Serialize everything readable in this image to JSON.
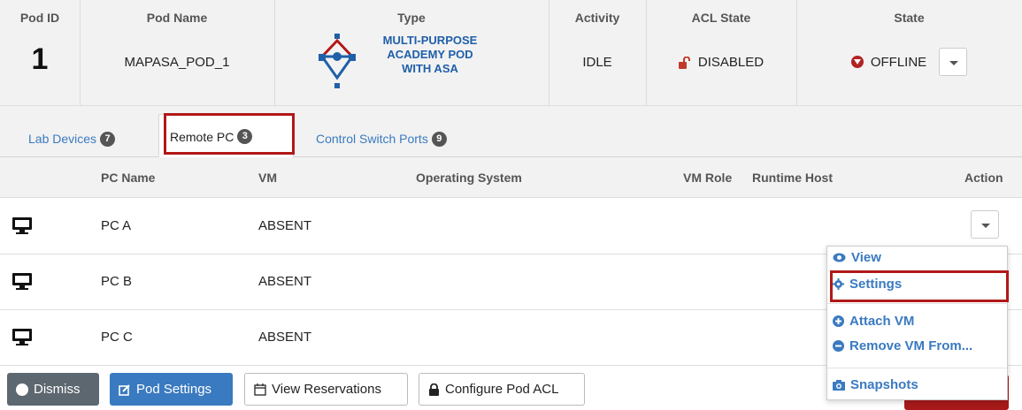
{
  "pod": {
    "headers": {
      "pod_id": "Pod ID",
      "pod_name": "Pod Name",
      "type": "Type",
      "activity": "Activity",
      "acl_state": "ACL State",
      "state": "State"
    },
    "pod_id": "1",
    "pod_name": "MAPASA_POD_1",
    "type_label_1": "MULTI-PURPOSE",
    "type_label_2": "ACADEMY POD",
    "type_label_3": "WITH ASA",
    "activity": "IDLE",
    "acl_state": "DISABLED",
    "state": "OFFLINE"
  },
  "tabs": [
    {
      "label": "Lab Devices",
      "count": "7",
      "active": false
    },
    {
      "label": "Remote PC",
      "count": "3",
      "active": true
    },
    {
      "label": "Control Switch Ports",
      "count": "9",
      "active": false
    }
  ],
  "pc_table": {
    "headers": {
      "pc_name": "PC Name",
      "vm": "VM",
      "os": "Operating System",
      "vm_role": "VM Role",
      "runtime_host": "Runtime Host",
      "action": "Action"
    },
    "rows": [
      {
        "name": "PC A",
        "vm": "ABSENT"
      },
      {
        "name": "PC B",
        "vm": "ABSENT"
      },
      {
        "name": "PC C",
        "vm": "ABSENT"
      }
    ]
  },
  "action_menu": {
    "items": [
      "View",
      "Settings",
      "Attach VM",
      "Remove VM From...",
      "Snapshots"
    ]
  },
  "footer": {
    "dismiss": "Dismiss",
    "pod_settings": "Pod Settings",
    "view_reservations": "View Reservations",
    "configure_pod_acl": "Configure Pod ACL"
  },
  "colors": {
    "accent": "#3a7ac0",
    "highlight": "#b21818",
    "offline": "#b22222",
    "unlock": "#c0392b"
  }
}
